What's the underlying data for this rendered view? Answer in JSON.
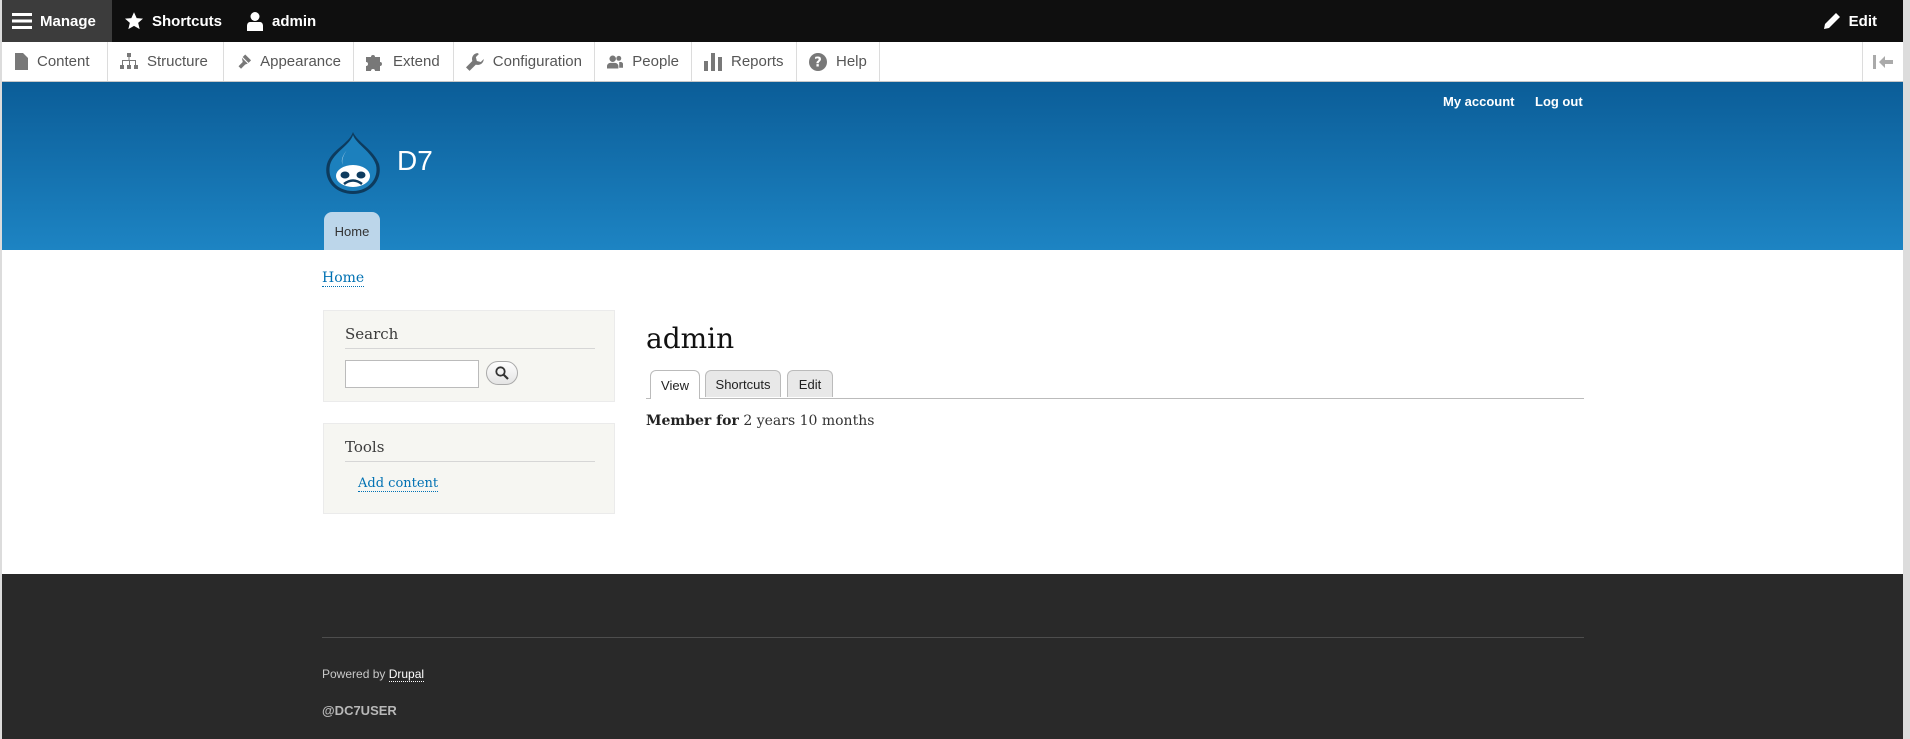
{
  "toolbar": {
    "manage_label": "Manage",
    "shortcuts_label": "Shortcuts",
    "user_label": "admin",
    "edit_label": "Edit"
  },
  "tray": {
    "items": [
      {
        "label": "Content",
        "icon": "file-icon"
      },
      {
        "label": "Structure",
        "icon": "sitemap-icon"
      },
      {
        "label": "Appearance",
        "icon": "paintbrush-icon"
      },
      {
        "label": "Extend",
        "icon": "puzzle-icon"
      },
      {
        "label": "Configuration",
        "icon": "wrench-icon"
      },
      {
        "label": "People",
        "icon": "people-icon"
      },
      {
        "label": "Reports",
        "icon": "bar-chart-icon"
      },
      {
        "label": "Help",
        "icon": "help-icon"
      }
    ]
  },
  "header": {
    "secondary_menu": [
      "My account",
      "Log out"
    ],
    "site_name": "D7",
    "main_menu_home": "Home"
  },
  "breadcrumb": "Home",
  "sidebar": {
    "search_title": "Search",
    "search_value": "",
    "tools_title": "Tools",
    "tools_link": "Add content"
  },
  "main": {
    "title": "admin",
    "tabs": [
      "View",
      "Shortcuts",
      "Edit"
    ],
    "member_label": "Member for",
    "member_value": "2 years 10 months"
  },
  "footer": {
    "powered_text": "Powered by",
    "powered_link": "Drupal",
    "handle": "@DC7USER"
  },
  "colors": {
    "toolbar_bg": "#0f0f0f",
    "header_top": "#0b5d98",
    "header_bottom": "#1d84c3",
    "link": "#0071b3",
    "footer_bg": "#292929"
  }
}
